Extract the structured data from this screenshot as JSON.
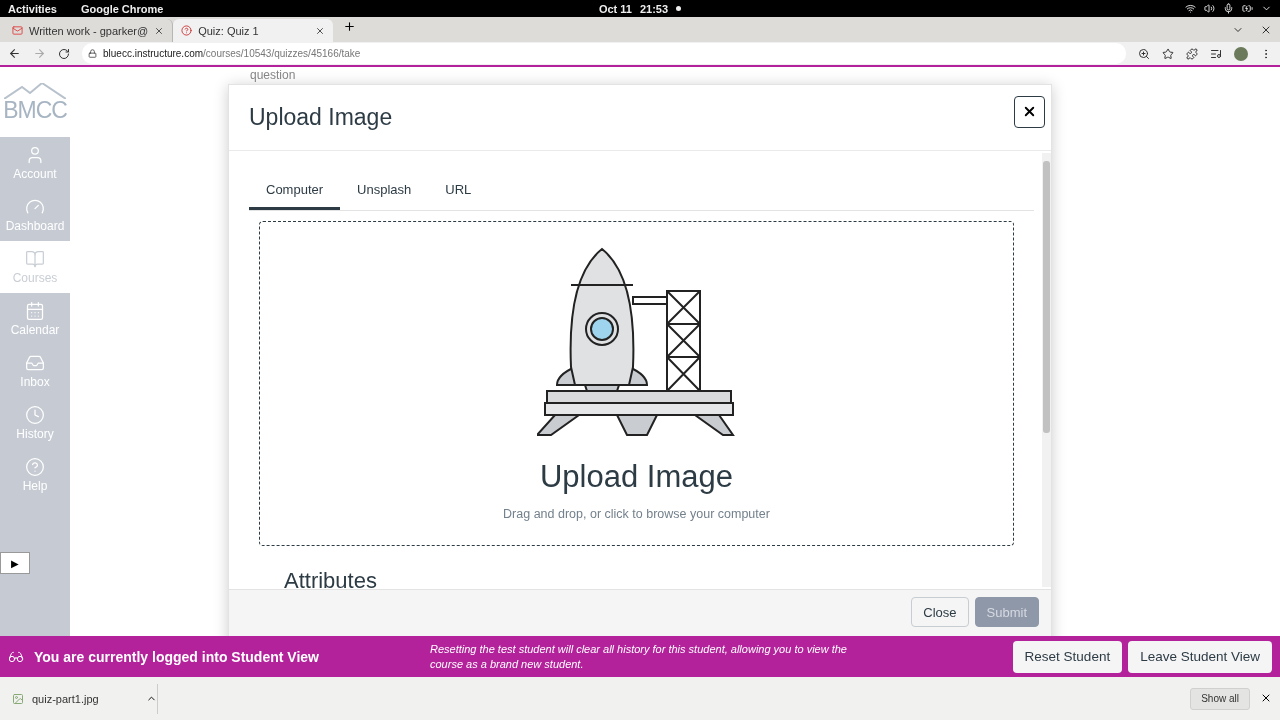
{
  "system_bar": {
    "activities": "Activities",
    "app": "Google Chrome",
    "date": "Oct 11",
    "time": "21:53"
  },
  "browser": {
    "tabs": [
      {
        "title": "Written work - gparker@",
        "kind": "mail",
        "selected": false
      },
      {
        "title": "Quiz: Quiz 1",
        "kind": "quiz",
        "selected": true
      }
    ],
    "address": {
      "host": "bluecc.instructure.com",
      "path": "/courses/10543/quizzes/45166/take"
    }
  },
  "sidebar": {
    "logo": "BMCC",
    "items": [
      {
        "label": "Account",
        "kind": "account",
        "selected": false
      },
      {
        "label": "Dashboard",
        "kind": "dashboard",
        "selected": false
      },
      {
        "label": "Courses",
        "kind": "courses",
        "selected": true
      },
      {
        "label": "Calendar",
        "kind": "calendar",
        "selected": false
      },
      {
        "label": "Inbox",
        "kind": "inbox",
        "selected": false
      },
      {
        "label": "History",
        "kind": "history",
        "selected": false
      },
      {
        "label": "Help",
        "kind": "help",
        "selected": false
      }
    ],
    "expand_button": "▶"
  },
  "page": {
    "faded_text": "question"
  },
  "modal": {
    "title": "Upload Image",
    "tabs": [
      {
        "label": "Computer",
        "selected": true
      },
      {
        "label": "Unsplash",
        "selected": false
      },
      {
        "label": "URL",
        "selected": false
      }
    ],
    "dropzone": {
      "heading": "Upload Image",
      "hint": "Drag and drop, or click to browse your computer"
    },
    "section_heading": "Attributes",
    "buttons": [
      {
        "label": "Close",
        "kind": "secondary",
        "disabled": false
      },
      {
        "label": "Submit",
        "kind": "primary",
        "disabled": true
      }
    ]
  },
  "student_view_banner": {
    "message": "You are currently logged into Student View",
    "note": "Resetting the test student will clear all history for this student, allowing you to view the course as a brand new student.",
    "buttons": [
      "Reset Student",
      "Leave Student View"
    ]
  },
  "downloads": {
    "file": "quiz-part1.jpg",
    "show_all": "Show all"
  }
}
